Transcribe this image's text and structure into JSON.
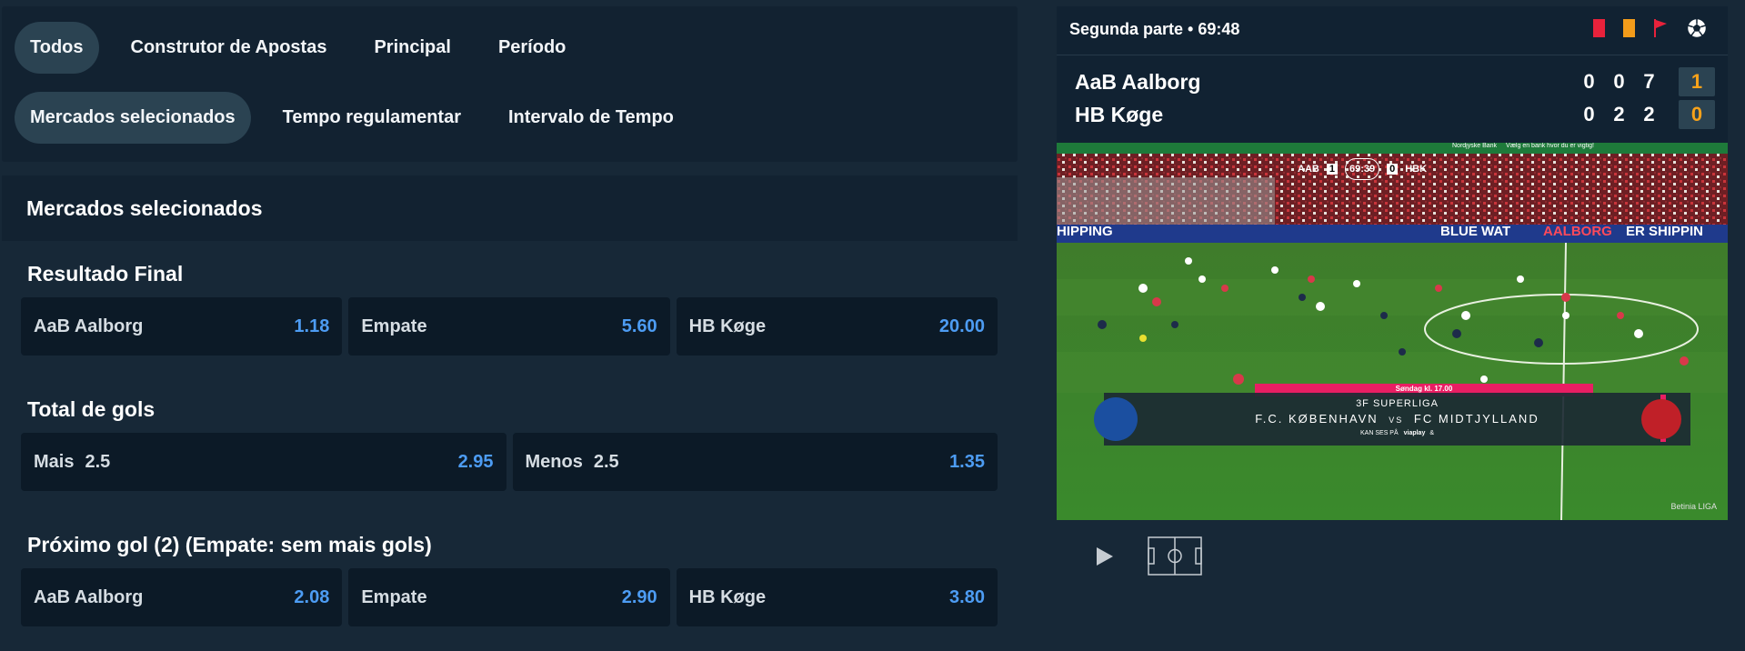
{
  "tabs": {
    "primary": [
      "Todos",
      "Construtor de Apostas",
      "Principal",
      "Período"
    ],
    "secondary": [
      "Mercados selecionados",
      "Tempo regulamentar",
      "Intervalo de Tempo"
    ]
  },
  "section_title": "Mercados selecionados",
  "markets": [
    {
      "title": "Resultado Final",
      "odds": [
        {
          "label": "AaB Aalborg",
          "line": "",
          "value": "1.18"
        },
        {
          "label": "Empate",
          "line": "",
          "value": "5.60"
        },
        {
          "label": "HB Køge",
          "line": "",
          "value": "20.00"
        }
      ]
    },
    {
      "title": "Total de gols",
      "odds": [
        {
          "label": "Mais",
          "line": "2.5",
          "value": "2.95"
        },
        {
          "label": "Menos",
          "line": "2.5",
          "value": "1.35"
        }
      ]
    },
    {
      "title": "Próximo gol (2) (Empate: sem mais gols)",
      "odds": [
        {
          "label": "AaB Aalborg",
          "line": "",
          "value": "2.08"
        },
        {
          "label": "Empate",
          "line": "",
          "value": "2.90"
        },
        {
          "label": "HB Køge",
          "line": "",
          "value": "3.80"
        }
      ]
    }
  ],
  "scoreboard": {
    "phase": "Segunda parte • 69:48",
    "status_icons": [
      "red-card-icon",
      "yellow-card-icon",
      "corner-flag-icon",
      "football-icon"
    ],
    "teams": [
      {
        "name": "AaB Aalborg",
        "periods": [
          "0",
          "0",
          "7"
        ],
        "total": "1"
      },
      {
        "name": "HB Køge",
        "periods": [
          "0",
          "2",
          "2"
        ],
        "total": "0"
      }
    ]
  },
  "video": {
    "overlay_score": {
      "home": "AAB",
      "home_goals": "1",
      "clock": "69:39",
      "away_goals": "0",
      "away": "HBK"
    },
    "banner": {
      "date": "Søndag kl. 17.00",
      "league": "3F SUPERLIGA",
      "home": "F.C. KØBENHAVN",
      "vs": "VS",
      "away": "FC MIDTJYLLAND",
      "sub": "KAN SES PÅ",
      "channel": "viaplay",
      "ad_tail": "&"
    },
    "boards": [
      "HIPPING",
      "BLUE WAT",
      "AALBORG",
      "ER SHIPPIN"
    ],
    "stand_text": [
      "Nordjyske Bank",
      "Vælg en bank hvor du er vigtig!"
    ],
    "watermark": "Betinia LIGA"
  },
  "controls": {
    "play_icon": "play-icon",
    "pitch_icon": "pitch-view-icon"
  },
  "colors": {
    "accent": "#4d9cf3",
    "score_total": "#f7a21a",
    "panel": "#122231",
    "background": "#172837"
  }
}
